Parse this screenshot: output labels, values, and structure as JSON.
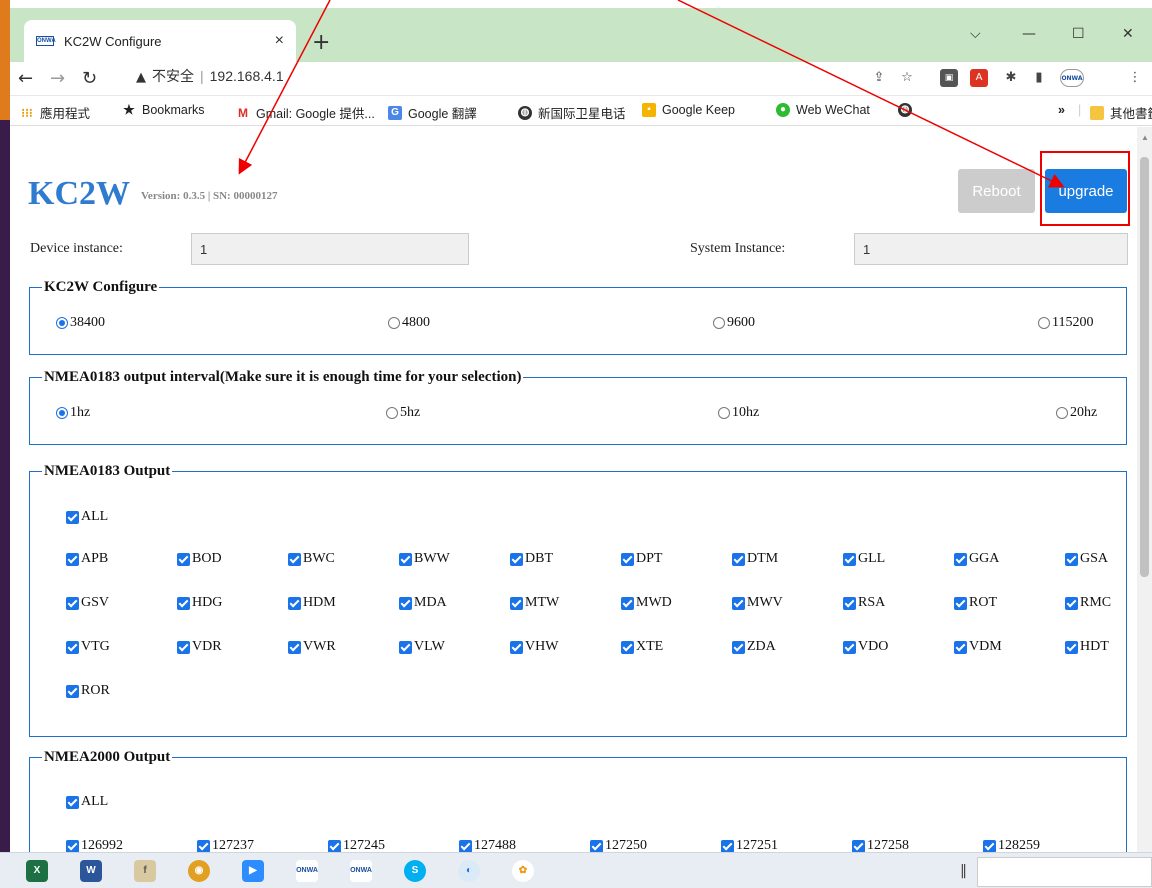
{
  "browser": {
    "tab_title": "KC2W Configure",
    "favicon_text": "ONWA",
    "tab_close": "×",
    "new_tab": "+",
    "window_controls": [
      "⌵",
      "—",
      "☐",
      "✕"
    ],
    "security_label": "不安全",
    "url": "192.168.4.1",
    "bookmarks": [
      "應用程式",
      "Bookmarks",
      "Gmail: Google 提供...",
      "Google 翻譯",
      "新国际卫星电话",
      "Google Keep",
      "Web WeChat"
    ],
    "bookmarks_more": "»",
    "other_bookmarks": "其他書籤"
  },
  "header": {
    "logo": "KC2W",
    "version": "Version: 0.3.5 | SN: 00000127",
    "reboot_label": "Reboot",
    "upgrade_label": "upgrade"
  },
  "fields": {
    "device_instance_label": "Device instance:",
    "device_instance_value": "1",
    "system_instance_label": "System Instance:",
    "system_instance_value": "1"
  },
  "configure": {
    "legend": "KC2W Configure",
    "options": [
      "38400",
      "4800",
      "9600",
      "115200"
    ],
    "selected": "38400"
  },
  "interval": {
    "legend": "NMEA0183 output interval(Make sure it is enough time for your selection)",
    "options": [
      "1hz",
      "5hz",
      "10hz",
      "20hz"
    ],
    "selected": "1hz"
  },
  "nmea0183": {
    "legend": "NMEA0183 Output",
    "all_label": "ALL",
    "items": [
      "APB",
      "BOD",
      "BWC",
      "BWW",
      "DBT",
      "DPT",
      "DTM",
      "GLL",
      "GGA",
      "GSA",
      "GSV",
      "HDG",
      "HDM",
      "MDA",
      "MTW",
      "MWD",
      "MWV",
      "RSA",
      "ROT",
      "RMC",
      "VTG",
      "VDR",
      "VWR",
      "VLW",
      "VHW",
      "XTE",
      "ZDA",
      "VDO",
      "VDM",
      "HDT",
      "ROR"
    ]
  },
  "nmea2000": {
    "legend": "NMEA2000 Output",
    "all_label": "ALL",
    "items": [
      "126992",
      "127237",
      "127245",
      "127488",
      "127250",
      "127251",
      "127258",
      "128259"
    ]
  },
  "taskbar": {
    "apps": [
      "excel-icon",
      "word-icon",
      "files-icon",
      "chrome-icon",
      "zoom-icon",
      "onwa-icon",
      "onwa-gps-icon",
      "skype-icon",
      "edge-icon",
      "pinwheel-icon"
    ]
  },
  "colors": {
    "accent": "#1a7be0",
    "fieldset_border": "#1f6fc8",
    "annotation": "#e00000"
  }
}
